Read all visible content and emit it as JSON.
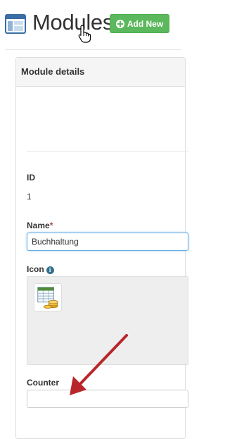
{
  "header": {
    "title": "Modules",
    "add_button_label": "Add New"
  },
  "panel": {
    "heading": "Module details",
    "fields": {
      "id_label": "ID",
      "id_value": "1",
      "name_label": "Name",
      "name_required_mark": "*",
      "name_value": "Buchhaltung",
      "icon_label": "Icon",
      "icon_info_glyph": "i",
      "counter_label": "Counter",
      "counter_value": ""
    }
  },
  "icons": {
    "modules": "modules-window-icon",
    "add": "plus-circle-icon",
    "info": "info-circle-icon",
    "selected_module_icon": "spreadsheet-coins-icon",
    "cursor": "hand-pointer-cursor",
    "annotation": "red-arrow"
  },
  "colors": {
    "success_button": "#5cb85c",
    "info_icon": "#31708f",
    "required_mark": "#a94442",
    "focus_border": "#66afe9",
    "annotation_arrow": "#b8262b"
  }
}
